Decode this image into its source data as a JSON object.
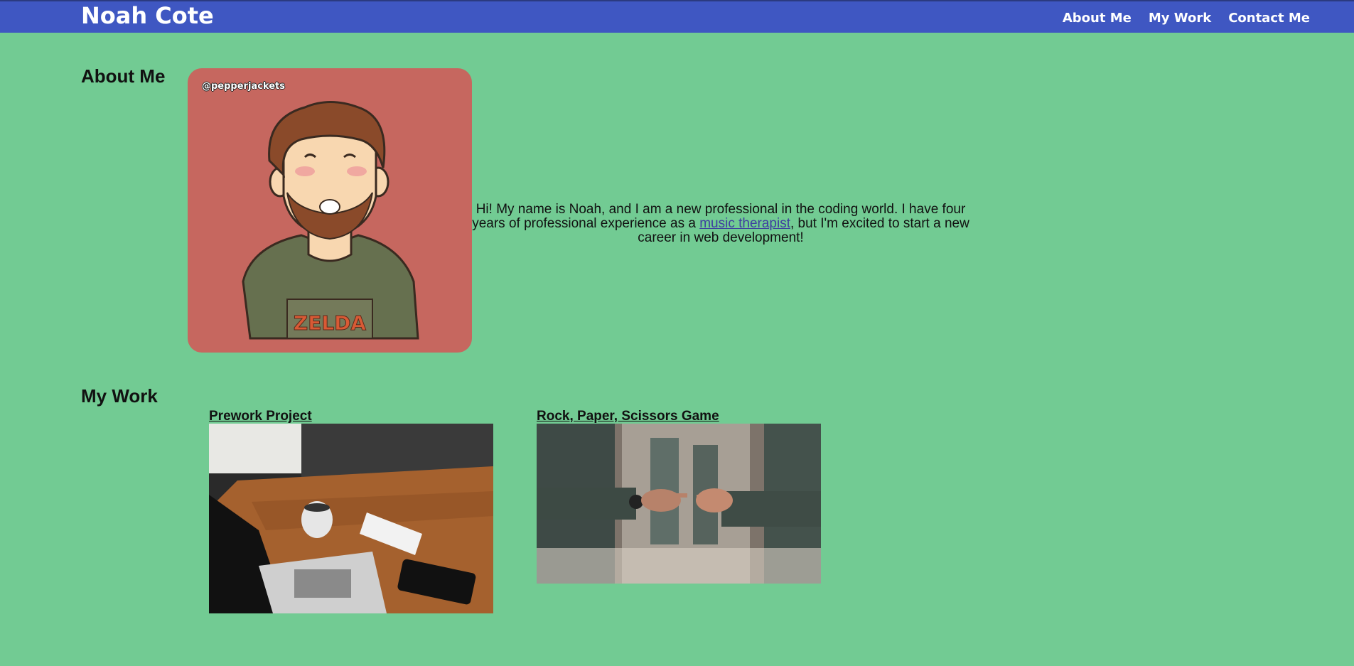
{
  "header": {
    "site_title": "Noah Cote",
    "nav": [
      {
        "label": "About Me"
      },
      {
        "label": "My Work"
      },
      {
        "label": "Contact Me"
      }
    ],
    "bg_color": "#3f57c2"
  },
  "about": {
    "heading": "About Me",
    "avatar_watermark": "@pepperjackets",
    "avatar_shirt_text": "ZELDA",
    "text_before_link": "Hi! My name is Noah, and I am a new professional in the coding world. I have four years of professional experience as a ",
    "link_text": "music therapist",
    "text_after_link": ", but I'm excited to start a new career in web development!"
  },
  "work": {
    "heading": "My Work",
    "projects": [
      {
        "title": "Prework Project",
        "image": "laptop-desk-photo"
      },
      {
        "title": "Rock, Paper, Scissors Game",
        "image": "rock-paper-scissors-photo"
      }
    ]
  },
  "colors": {
    "page_bg": "#72cb93",
    "link": "#3e3ea0",
    "avatar_bg": "#c6675f"
  }
}
